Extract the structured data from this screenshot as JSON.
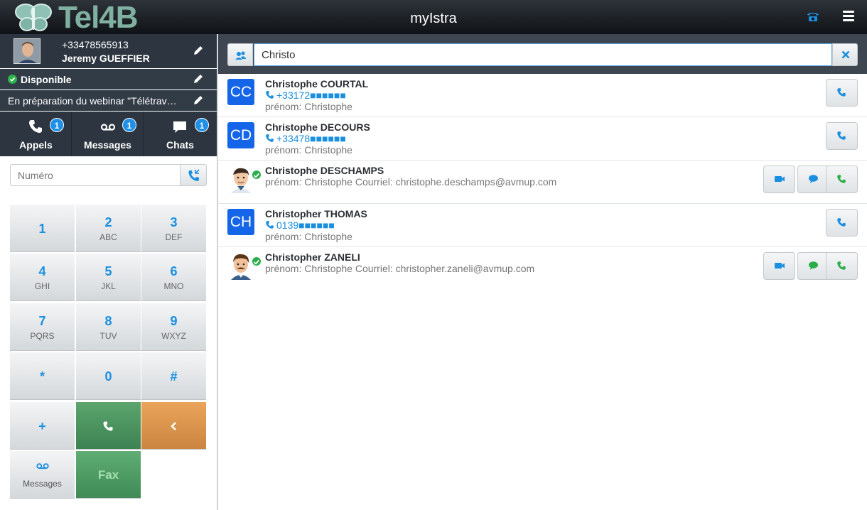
{
  "app": {
    "title": "myIstra",
    "logo_text": "Tel4B"
  },
  "user": {
    "phone": "+33478565913",
    "name": "Jeremy GUEFFIER",
    "status": "Disponible",
    "note": "En préparation du webinar \"Télétrav…"
  },
  "tabs": [
    {
      "label": "Appels",
      "badge": "1",
      "icon": "phone-icon"
    },
    {
      "label": "Messages",
      "badge": "1",
      "icon": "voicemail-icon"
    },
    {
      "label": "Chats",
      "badge": "1",
      "icon": "chat-icon"
    }
  ],
  "dialer": {
    "placeholder": "Numéro",
    "keys": [
      {
        "digit": "1",
        "letters": ""
      },
      {
        "digit": "2",
        "letters": "ABC"
      },
      {
        "digit": "3",
        "letters": "DEF"
      },
      {
        "digit": "4",
        "letters": "GHI"
      },
      {
        "digit": "5",
        "letters": "JKL"
      },
      {
        "digit": "6",
        "letters": "MNO"
      },
      {
        "digit": "7",
        "letters": "PQRS"
      },
      {
        "digit": "8",
        "letters": "TUV"
      },
      {
        "digit": "9",
        "letters": "WXYZ"
      },
      {
        "digit": "*",
        "letters": ""
      },
      {
        "digit": "0",
        "letters": ""
      },
      {
        "digit": "#",
        "letters": ""
      },
      {
        "digit": "+",
        "letters": ""
      }
    ],
    "messages_label": "Messages",
    "fax_label": "Fax"
  },
  "search": {
    "value": "Christo"
  },
  "contacts": [
    {
      "initials": "CC",
      "name": "Christophe COURTAL",
      "phone": "+33172■■■■■■",
      "sub": "prénom: Christophe"
    },
    {
      "initials": "CD",
      "name": "Christophe DECOURS",
      "phone": "+33478■■■■■■",
      "sub": "prénom: Christophe"
    },
    {
      "name": "Christophe DESCHAMPS",
      "sub": "prénom: Christophe Courriel: christophe.deschamps@avmup.com"
    },
    {
      "initials": "CH",
      "name": "Christopher THOMAS",
      "phone": "0139■■■■■■",
      "sub": "prénom: Christophe"
    },
    {
      "name": "Christopher ZANELI",
      "sub": "prénom: Christophe Courriel: christopher.zaneli@avmup.com"
    }
  ],
  "colors": {
    "accent": "#1a8fe0",
    "initials_bg": "#1565e8",
    "online": "#2bae4a",
    "call_key": "#4b935f",
    "back_key": "#dd944d"
  }
}
